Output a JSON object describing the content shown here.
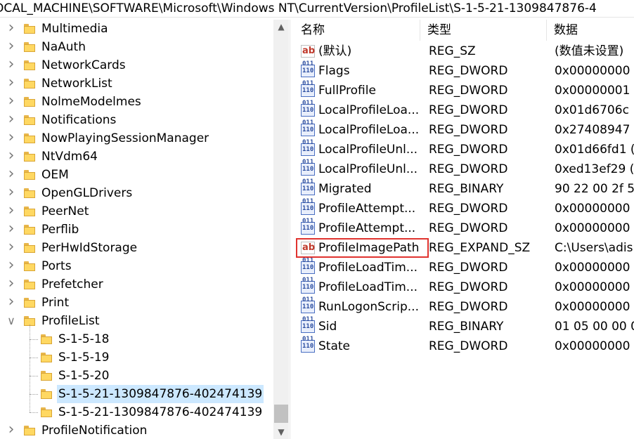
{
  "address": "OCAL_MACHINE\\SOFTWARE\\Microsoft\\Windows NT\\CurrentVersion\\ProfileList\\S-1-5-21-1309847876-4",
  "tree": [
    {
      "label": "Multimedia",
      "expanded": false
    },
    {
      "label": "NaAuth",
      "expanded": false
    },
    {
      "label": "NetworkCards",
      "expanded": false
    },
    {
      "label": "NetworkList",
      "expanded": false
    },
    {
      "label": "NolmeModelmes",
      "expanded": false
    },
    {
      "label": "Notifications",
      "expanded": false
    },
    {
      "label": "NowPlayingSessionManager",
      "expanded": false
    },
    {
      "label": "NtVdm64",
      "expanded": false
    },
    {
      "label": "OEM",
      "expanded": false
    },
    {
      "label": "OpenGLDrivers",
      "expanded": false
    },
    {
      "label": "PeerNet",
      "expanded": false
    },
    {
      "label": "Perflib",
      "expanded": false
    },
    {
      "label": "PerHwIdStorage",
      "expanded": false
    },
    {
      "label": "Ports",
      "expanded": false
    },
    {
      "label": "Prefetcher",
      "expanded": false
    },
    {
      "label": "Print",
      "expanded": false
    },
    {
      "label": "ProfileList",
      "expanded": true
    },
    {
      "label": "S-1-5-18",
      "child": true
    },
    {
      "label": "S-1-5-19",
      "child": true
    },
    {
      "label": "S-1-5-20",
      "child": true
    },
    {
      "label": "S-1-5-21-1309847876-402474139",
      "child": true,
      "selected": true
    },
    {
      "label": "S-1-5-21-1309847876-402474139",
      "child": true
    },
    {
      "label": "ProfileNotification",
      "expanded": false
    }
  ],
  "columns": {
    "name": "名称",
    "type": "类型",
    "data": "数据"
  },
  "values": [
    {
      "icon": "string",
      "name": "(默认)",
      "type": "REG_SZ",
      "data": "(数值未设置)"
    },
    {
      "icon": "binary",
      "name": "Flags",
      "type": "REG_DWORD",
      "data": "0x00000000"
    },
    {
      "icon": "binary",
      "name": "FullProfile",
      "type": "REG_DWORD",
      "data": "0x00000001"
    },
    {
      "icon": "binary",
      "name": "LocalProfileLoa...",
      "type": "REG_DWORD",
      "data": "0x01d6706c"
    },
    {
      "icon": "binary",
      "name": "LocalProfileLoa...",
      "type": "REG_DWORD",
      "data": "0x27408947"
    },
    {
      "icon": "binary",
      "name": "LocalProfileUnl...",
      "type": "REG_DWORD",
      "data": "0x01d66fd1 ("
    },
    {
      "icon": "binary",
      "name": "LocalProfileUnl...",
      "type": "REG_DWORD",
      "data": "0xed13ef29 ("
    },
    {
      "icon": "binary",
      "name": "Migrated",
      "type": "REG_BINARY",
      "data": "90 22 00 2f 5"
    },
    {
      "icon": "binary",
      "name": "ProfileAttempt...",
      "type": "REG_DWORD",
      "data": "0x00000000"
    },
    {
      "icon": "binary",
      "name": "ProfileAttempt...",
      "type": "REG_DWORD",
      "data": "0x00000000"
    },
    {
      "icon": "string",
      "name": "ProfileImagePath",
      "type": "REG_EXPAND_SZ",
      "data": "C:\\Users\\adis"
    },
    {
      "icon": "binary",
      "name": "ProfileLoadTim...",
      "type": "REG_DWORD",
      "data": "0x00000000"
    },
    {
      "icon": "binary",
      "name": "ProfileLoadTim...",
      "type": "REG_DWORD",
      "data": "0x00000000"
    },
    {
      "icon": "binary",
      "name": "RunLogonScrip...",
      "type": "REG_DWORD",
      "data": "0x00000000"
    },
    {
      "icon": "binary",
      "name": "Sid",
      "type": "REG_BINARY",
      "data": "01 05 00 00 0"
    },
    {
      "icon": "binary",
      "name": "State",
      "type": "REG_DWORD",
      "data": "0x00000000"
    }
  ],
  "icon_glyphs": {
    "string": "ab",
    "binary": "011\n110"
  },
  "colors": {
    "selection": "#cce8ff",
    "highlight_border": "#e0332f",
    "folder": "#ffd862"
  }
}
